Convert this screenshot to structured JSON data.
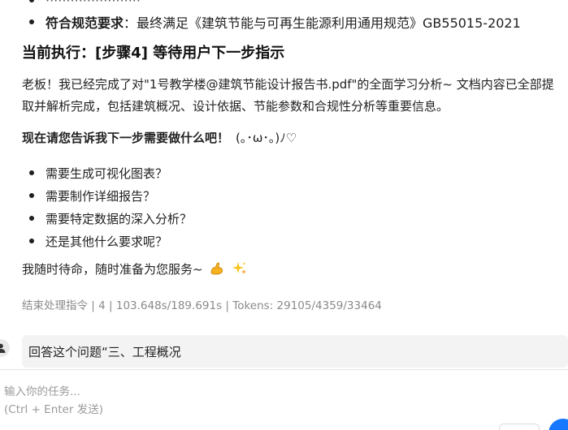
{
  "top_bullets": [
    {
      "label": "",
      "text": "·······················"
    },
    {
      "label": "符合规范要求",
      "text": "：最终满足《建筑节能与可再生能源利用通用规范》GB55015-2021"
    }
  ],
  "heading": "当前执行：[步骤4] 等待用户下一步指示",
  "paragraph": "老板！我已经完成了对\"1号教学楼@建筑节能设计报告书.pdf\"的全面学习分析~ 文档内容已全部提取并解析完成，包括建筑概况、设计依据、节能参数和合规性分析等重要信息。",
  "question": {
    "bold": "现在请您告诉我下一步需要做什么吧！",
    "kaomoji": "(｡･ω･｡)ﾉ♡"
  },
  "options": [
    "需要生成可视化图表？",
    "需要制作详细报告？",
    "需要特定数据的深入分析？",
    "还是其他什么要求呢？"
  ],
  "closing": "我随时待命，随时准备为您服务~",
  "icons": {
    "closing_1": "flexed-biceps-icon",
    "closing_2": "sparkles-icon",
    "user": "user-icon"
  },
  "stats": "结束处理指令 | 4 | 103.648s/189.691s | Tokens: 29105/4359/33464",
  "user_message": "回答这个问题“三、工程概况",
  "input": {
    "placeholder_line1": "输入你的任务...",
    "placeholder_line2": "(Ctrl + Enter 发送)"
  },
  "colors": {
    "accent": "#1677ff",
    "muted": "#8a8a8a",
    "bubble": "#f3f3f3"
  }
}
